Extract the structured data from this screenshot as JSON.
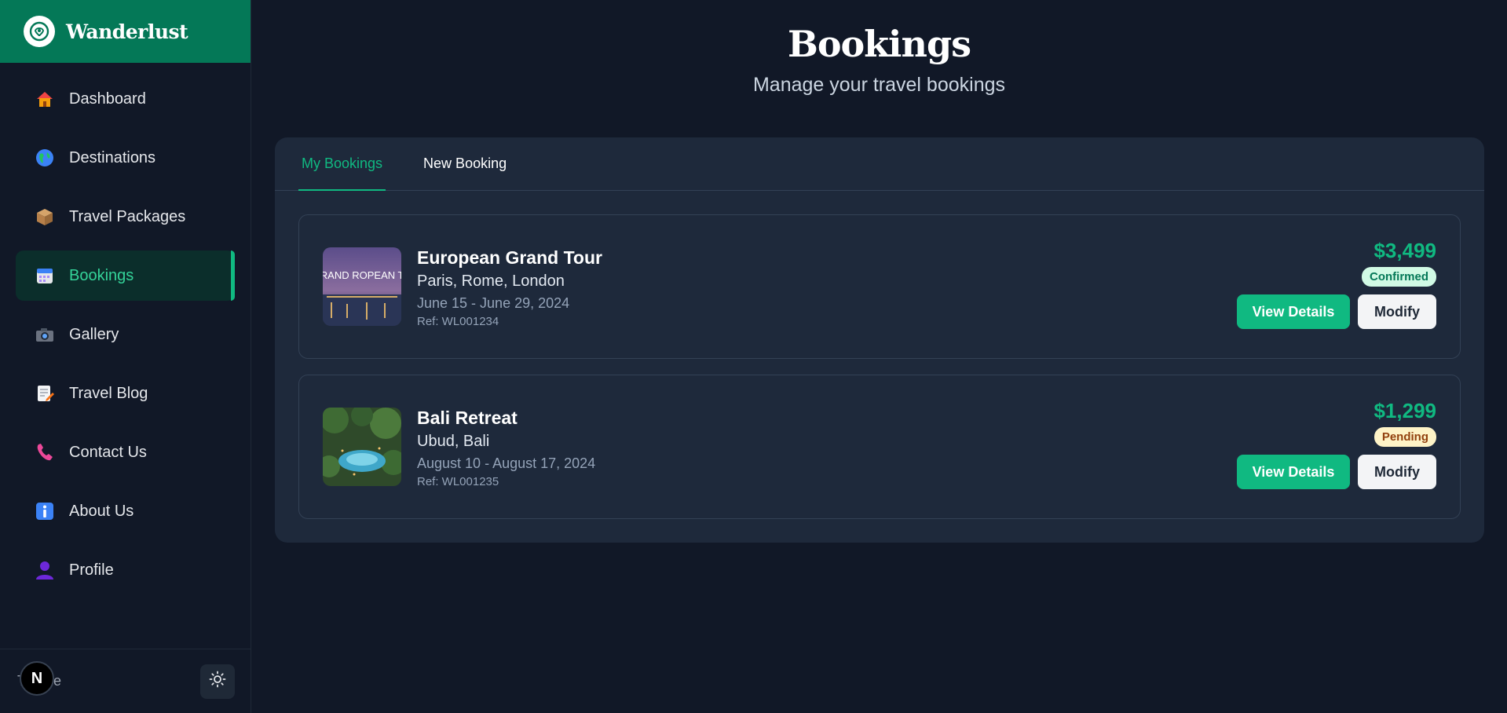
{
  "brand": {
    "name": "Wanderlust"
  },
  "sidebar": {
    "items": [
      {
        "label": "Dashboard",
        "icon": "house-icon"
      },
      {
        "label": "Destinations",
        "icon": "globe-icon"
      },
      {
        "label": "Travel Packages",
        "icon": "package-icon"
      },
      {
        "label": "Bookings",
        "icon": "calendar-icon",
        "active": true
      },
      {
        "label": "Gallery",
        "icon": "camera-icon"
      },
      {
        "label": "Travel Blog",
        "icon": "memo-icon"
      },
      {
        "label": "Contact Us",
        "icon": "phone-icon"
      },
      {
        "label": "About Us",
        "icon": "info-icon"
      },
      {
        "label": "Profile",
        "icon": "person-icon"
      }
    ],
    "footer": {
      "theme_label": "Theme",
      "badge": "N"
    }
  },
  "header": {
    "title": "Bookings",
    "subtitle": "Manage your travel bookings"
  },
  "tabs": [
    {
      "label": "My Bookings",
      "active": true
    },
    {
      "label": "New Booking",
      "active": false
    }
  ],
  "bookings": [
    {
      "title": "European Grand Tour",
      "location": "Paris, Rome, London",
      "dates": "June 15 - June 29, 2024",
      "ref": "Ref: WL001234",
      "price": "$3,499",
      "status": "Confirmed",
      "thumb_text": "GRAND ROPEAN TO",
      "view_label": "View Details",
      "modify_label": "Modify"
    },
    {
      "title": "Bali Retreat",
      "location": "Ubud, Bali",
      "dates": "August 10 - August 17, 2024",
      "ref": "Ref: WL001235",
      "price": "$1,299",
      "status": "Pending",
      "view_label": "View Details",
      "modify_label": "Modify"
    }
  ],
  "colors": {
    "accent": "#10b981",
    "brand_bg": "#047857",
    "background": "#111827",
    "panel": "#1e293b"
  }
}
